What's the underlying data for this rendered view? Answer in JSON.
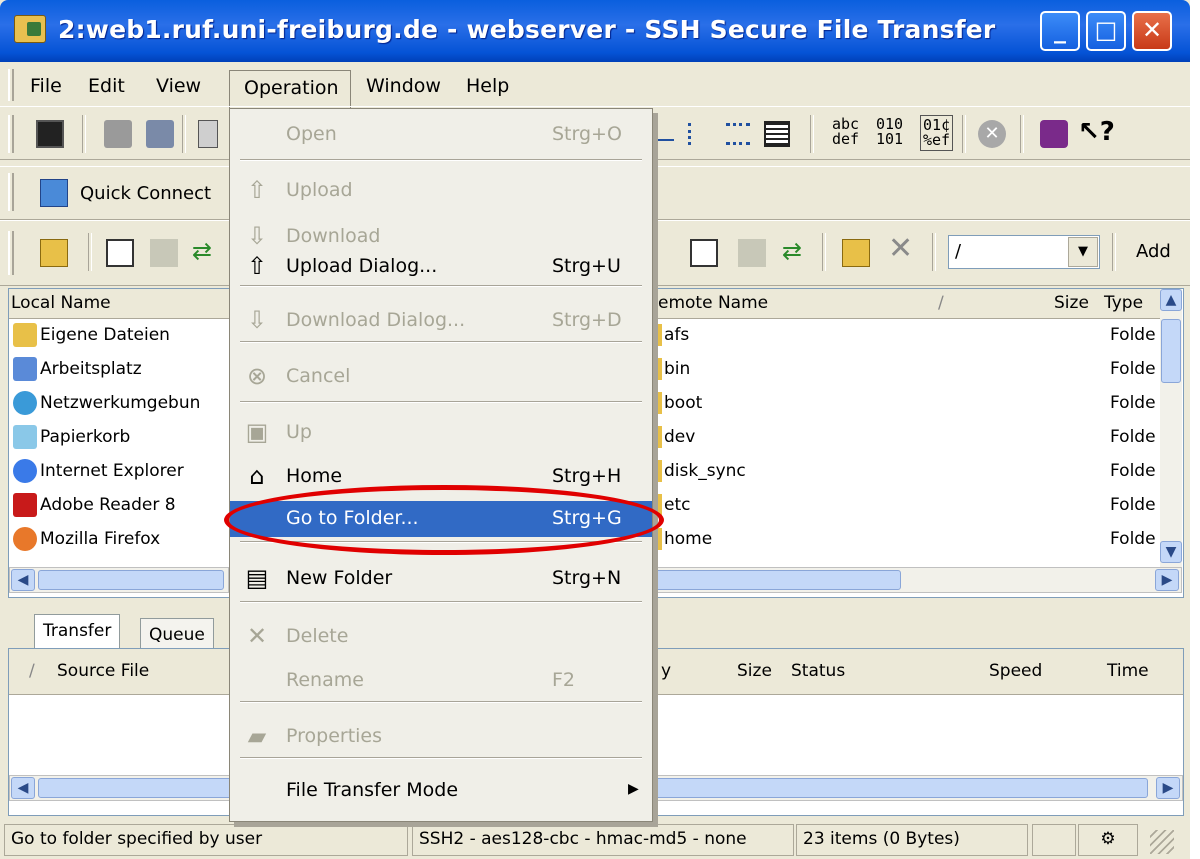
{
  "window": {
    "title": "2:web1.ruf.uni-freiburg.de - webserver - SSH Secure File Transfer"
  },
  "menubar": {
    "items": [
      "File",
      "Edit",
      "View",
      "Operation",
      "Window",
      "Help"
    ]
  },
  "toolbar": {
    "quick_connect": "Quick Connect",
    "path_value": "/",
    "add_label": "Add"
  },
  "local_pane": {
    "header": "Local Name",
    "items": [
      "Eigene Dateien",
      "Arbeitsplatz",
      "Netzwerkumgebun",
      "Papierkorb",
      "Internet Explorer",
      "Adobe Reader 8",
      "Mozilla Firefox"
    ]
  },
  "remote_pane": {
    "headers": {
      "name": "emote Name",
      "size": "Size",
      "type": "Type"
    },
    "items": [
      {
        "name": "afs",
        "type": "Folde"
      },
      {
        "name": "bin",
        "type": "Folde"
      },
      {
        "name": "boot",
        "type": "Folde"
      },
      {
        "name": "dev",
        "type": "Folde"
      },
      {
        "name": "disk_sync",
        "type": "Folde"
      },
      {
        "name": "etc",
        "type": "Folde"
      },
      {
        "name": "home",
        "type": "Folde"
      }
    ]
  },
  "transfer": {
    "tabs": [
      "Transfer",
      "Queue"
    ],
    "headers": {
      "source": "Source File",
      "y": "y",
      "size": "Size",
      "status": "Status",
      "speed": "Speed",
      "time": "Time"
    }
  },
  "operation_menu": {
    "items": [
      {
        "label": "Open",
        "accel": "Strg+O",
        "enabled": false,
        "icon": ""
      },
      {
        "label": "Upload",
        "accel": "",
        "enabled": false,
        "icon": "upload-arrow-icon"
      },
      {
        "label": "Download",
        "accel": "",
        "enabled": false,
        "icon": "download-arrow-icon"
      },
      {
        "label": "Upload Dialog...",
        "accel": "Strg+U",
        "enabled": true,
        "icon": "upload-arrow-icon"
      },
      {
        "label": "Download Dialog...",
        "accel": "Strg+D",
        "enabled": false,
        "icon": "download-arrow-icon"
      },
      {
        "label": "Cancel",
        "accel": "",
        "enabled": false,
        "icon": "cancel-icon"
      },
      {
        "label": "Up",
        "accel": "",
        "enabled": false,
        "icon": "folder-up-icon"
      },
      {
        "label": "Home",
        "accel": "Strg+H",
        "enabled": true,
        "icon": "home-icon"
      },
      {
        "label": "Go to Folder...",
        "accel": "Strg+G",
        "enabled": true,
        "highlighted": true,
        "icon": ""
      },
      {
        "label": "New Folder",
        "accel": "Strg+N",
        "enabled": true,
        "icon": "new-folder-icon"
      },
      {
        "label": "Delete",
        "accel": "",
        "enabled": false,
        "icon": "delete-x-icon"
      },
      {
        "label": "Rename",
        "accel": "F2",
        "enabled": false,
        "icon": ""
      },
      {
        "label": "Properties",
        "accel": "",
        "enabled": false,
        "icon": "properties-icon"
      },
      {
        "label": "File Transfer Mode",
        "accel": "",
        "enabled": true,
        "submenu": true,
        "icon": ""
      }
    ]
  },
  "statusbar": {
    "message": "Go to folder specified by user",
    "connection": "SSH2 - aes128-cbc - hmac-md5 - none",
    "items": "23 items (0 Bytes)"
  },
  "colors": {
    "title_blue": "#0a5fde",
    "menu_highlight": "#316ac5",
    "annotation_red": "#e00000"
  }
}
